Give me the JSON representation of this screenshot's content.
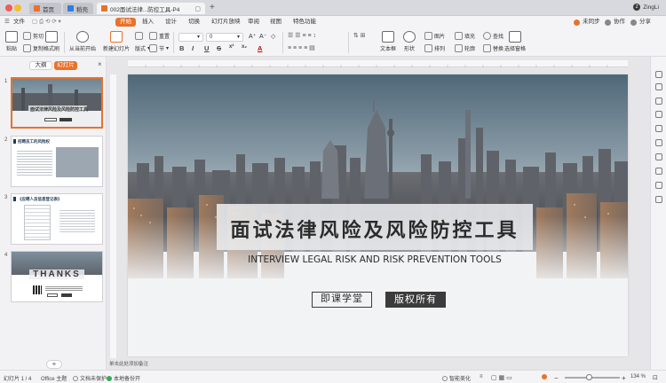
{
  "window": {
    "tabs": [
      {
        "label": "首页",
        "color": "#e8722c"
      },
      {
        "label": "稻壳",
        "color": "#2f7de1"
      },
      {
        "label": "002面试法律...防控工具-P4",
        "color": "#e8722c"
      }
    ],
    "new_tab": "+",
    "user_name": "ZingLi",
    "user_initial": "Z"
  },
  "menu": {
    "file": "文件",
    "items": [
      "开始",
      "插入",
      "设计",
      "切换",
      "幻灯片放映",
      "审阅",
      "视图",
      "特色功能"
    ],
    "share": "未同步",
    "collab": "协作",
    "share_btn": "分享"
  },
  "ribbon": {
    "paste": "粘贴",
    "cut": "剪切",
    "copy": "复制",
    "format_painter": "格式刷",
    "play_from_current": "从当前开始",
    "new_slide": "新建幻灯片",
    "layout": "版式",
    "section": "节",
    "reset": "重置",
    "font_size": "0",
    "text_box": "文本框",
    "shape": "形状",
    "image": "图片",
    "arrange": "排列",
    "fill": "填充",
    "outline": "轮廓",
    "find": "查找",
    "replace": "替换",
    "select_pane": "选择窗格",
    "format_buttons": [
      "B",
      "I",
      "U",
      "S",
      "x²",
      "x₂",
      "A"
    ]
  },
  "left_panel": {
    "outline_tab": "大纲",
    "slides_tab": "幻灯片",
    "close": "×",
    "add": "+",
    "thumbnails": [
      {
        "num": "1",
        "title": "面试法律风险及风险防控工具"
      },
      {
        "num": "2",
        "title": "招聘员工的风险权"
      },
      {
        "num": "3",
        "title": "《应聘人员信息登记表》"
      },
      {
        "num": "4",
        "title": "THANKS"
      }
    ]
  },
  "slide": {
    "title_cn": "面试法律风险及风险防控工具",
    "title_en": "INTERVIEW LEGAL RISK AND RISK PREVENTION TOOLS",
    "btn_left": "即课学堂",
    "btn_right": "版权所有"
  },
  "notes": "单击此处添加备注",
  "status": {
    "slide_count": "幻灯片 1 / 4",
    "theme": "Office 主题",
    "doc_protected": "文档未保护",
    "backup": "本地备份开",
    "beautify": "智能美化",
    "notes_toggle": "≡",
    "zoom": "134 %",
    "zoom_level": 0.45
  },
  "colors": {
    "accent": "#e8722c",
    "dark_button": "#3b3b3b"
  }
}
